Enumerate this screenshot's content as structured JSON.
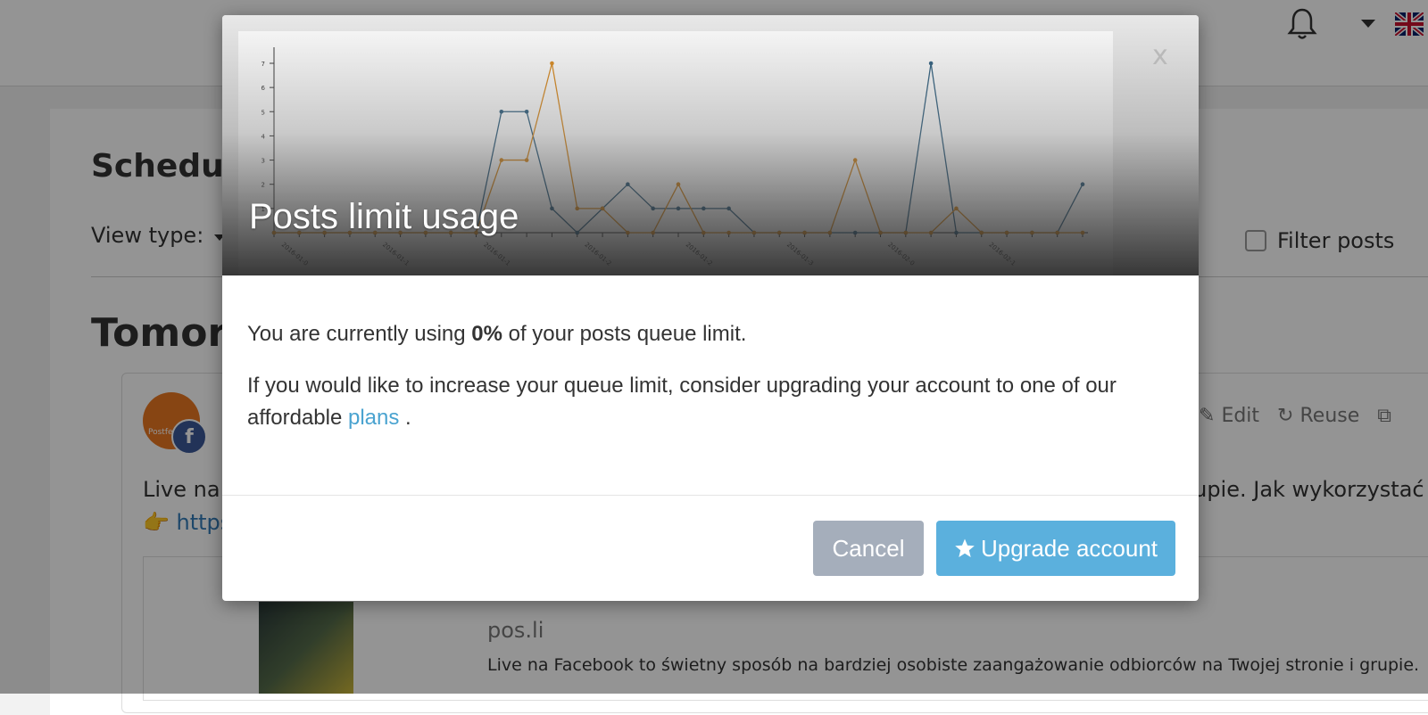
{
  "background": {
    "section_title": "Schedule",
    "view_type_label": "View type:",
    "filter_label": "Filter posts",
    "day_heading": "Tomorr",
    "avatar_label": "Postfe",
    "facebook_badge": "f",
    "post_actions": [
      "w",
      "Edit",
      "Reuse",
      ""
    ],
    "post_text_left": "Live na F",
    "post_text_right": "grupie. Jak wykorzystać",
    "post_link": "👉 https",
    "preview_domain": "pos.li",
    "preview_description": "Live na Facebook to świetny sposób na bardziej osobiste zaangażowanie odbiorców na Twojej stronie i grupie."
  },
  "modal": {
    "title": "Posts limit usage",
    "close_label": "x",
    "usage_prefix": "You are currently using ",
    "usage_value": "0%",
    "usage_suffix": " of your posts queue limit.",
    "upgrade_text": "If you would like to increase your queue limit, consider upgrading your account to one of our affordable ",
    "plans_link": "plans",
    "upgrade_text_end": " .",
    "cancel_button": "Cancel",
    "upgrade_button": "Upgrade account"
  },
  "chart_data": {
    "type": "line",
    "x": [
      "2016-01-01",
      "2016-01-03",
      "2016-01-05",
      "2016-01-07",
      "2016-01-09",
      "2016-01-11",
      "2016-01-13",
      "2016-01-15",
      "2016-01-17",
      "2016-01-19",
      "2016-01-21",
      "2016-01-23",
      "2016-01-25",
      "2016-01-27",
      "2016-01-29",
      "2016-01-31",
      "2016-02-02",
      "2016-02-04",
      "2016-02-06",
      "2016-02-08",
      "2016-02-10",
      "2016-02-12",
      "2016-02-14",
      "2016-02-16",
      "2016-02-18",
      "2016-02-20",
      "2016-02-22",
      "2016-02-24",
      "2016-02-26",
      "2016-02-28",
      "2016-03-01",
      "2016-03-03",
      "2016-03-05"
    ],
    "x_tick_labels": [
      "2016-01-0",
      "2016-01-1",
      "2016-01-1",
      "2016-01-2",
      "2016-01-2",
      "2016-01-3",
      "2016-02-0",
      "2016-02-1"
    ],
    "ylim": [
      0,
      7
    ],
    "y_ticks": [
      1,
      2,
      3,
      4,
      5,
      6,
      7
    ],
    "series": [
      {
        "color": "#2f5f7f",
        "values": [
          0,
          0,
          0,
          0,
          0,
          0,
          0,
          0,
          0,
          5,
          5,
          1,
          0,
          1,
          2,
          1,
          1,
          1,
          1,
          0,
          0,
          0,
          0,
          0,
          0,
          0,
          7,
          0,
          0,
          0,
          0,
          0,
          2
        ]
      },
      {
        "color": "#d98a1f",
        "values": [
          0,
          0,
          0,
          0,
          0,
          0,
          0,
          0,
          0,
          3,
          3,
          7,
          1,
          1,
          0,
          0,
          2,
          0,
          0,
          0,
          0,
          0,
          0,
          3,
          0,
          0,
          0,
          1,
          0,
          0,
          0,
          0,
          0
        ]
      }
    ],
    "grid": false
  }
}
